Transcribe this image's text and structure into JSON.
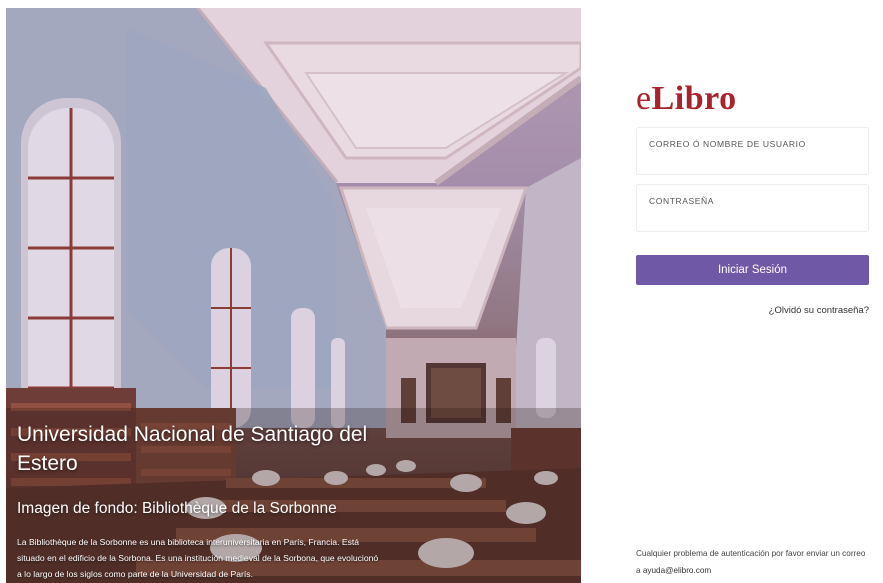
{
  "hero": {
    "title": "Universidad Nacional de Santiago del Estero",
    "subtitle": "Imagen de fondo: Bibliothèque de la Sorbonne",
    "description": "La Bibliothèque de la Sorbonne es una biblioteca interuniversitaria en París, Francia. Está situado en el edificio de la Sorbona. Es una institución medieval de la Sorbona, que evolucionó a lo largo de los siglos como parte de la Universidad de París."
  },
  "logo": {
    "prefix": "e",
    "name": "Libro",
    "color": "#a8232b"
  },
  "login": {
    "username_placeholder": "CORREO Ó NOMBRE DE USUARIO",
    "username_value": "",
    "password_placeholder": "CONTRASEÑA",
    "password_value": "",
    "submit_label": "Iniciar Sesión",
    "button_color": "#6f58a6",
    "forgot_label": "¿Olvidó su contraseña?"
  },
  "help": {
    "text": "Cualquier problema de autenticación por favor enviar un correo a",
    "email": "ayuda@elibro.com"
  }
}
